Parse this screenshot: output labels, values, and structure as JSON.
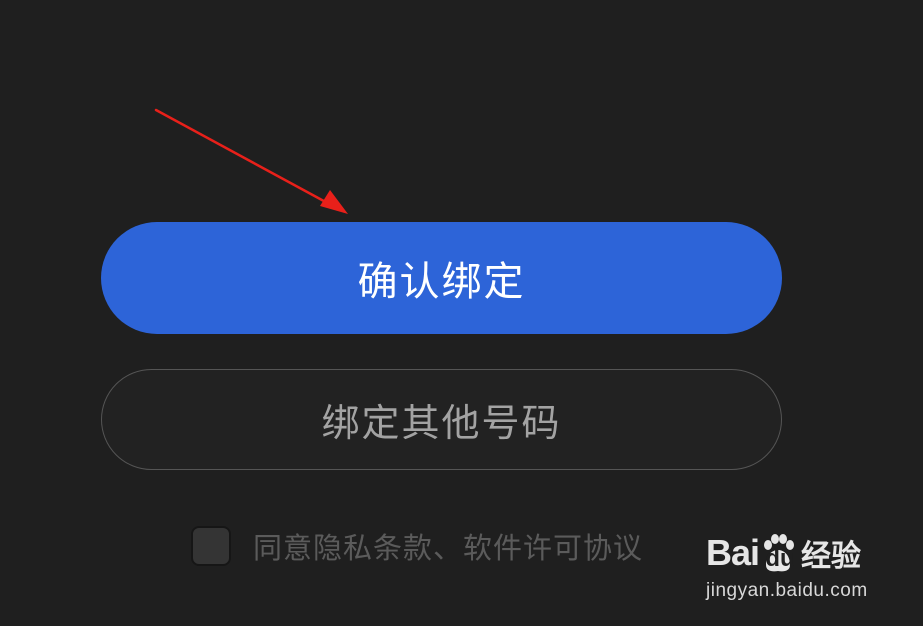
{
  "buttons": {
    "confirm_bind": "确认绑定",
    "bind_other_number": "绑定其他号码"
  },
  "agreement": {
    "checked": false,
    "label": "同意隐私条款、软件许可协议"
  },
  "watermark": {
    "brand_prefix": "Bai",
    "brand_du": "du",
    "brand_suffix": "经验",
    "url": "jingyan.baidu.com"
  },
  "colors": {
    "background": "#1f1f1f",
    "primary_button": "#2d64d8",
    "annotation_arrow": "#e8201a"
  },
  "icons": {
    "annotation": "red-arrow-icon",
    "logo": "baidu-paw-icon"
  }
}
